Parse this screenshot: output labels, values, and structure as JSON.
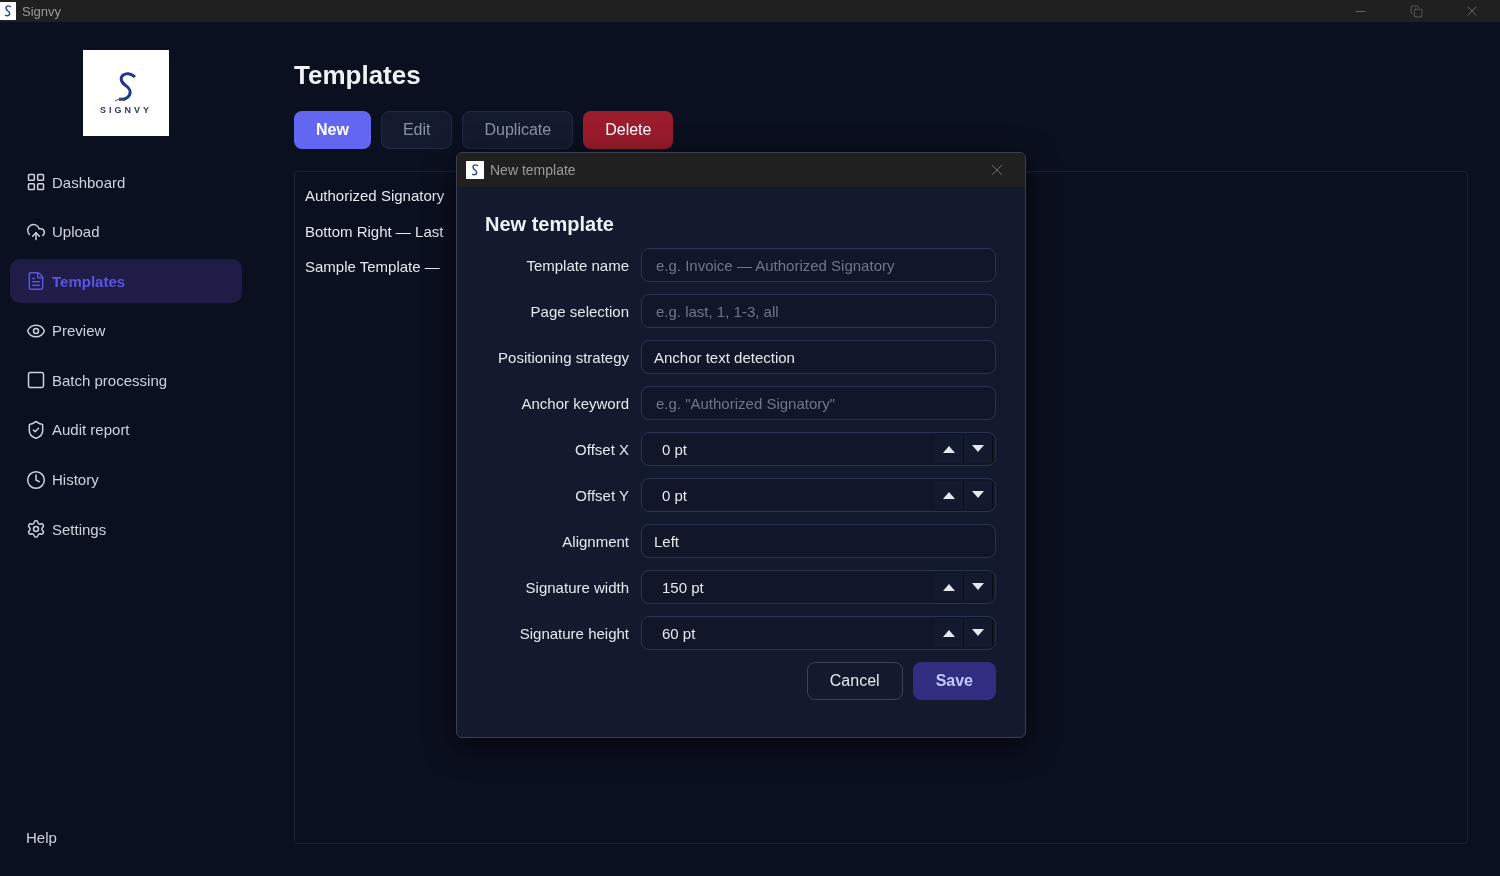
{
  "window": {
    "title": "Signvy"
  },
  "logo": {
    "wordmark": "SIGNVY"
  },
  "sidebar": {
    "items": [
      {
        "label": "Dashboard",
        "selected": false
      },
      {
        "label": "Upload",
        "selected": false
      },
      {
        "label": "Templates",
        "selected": true
      },
      {
        "label": "Preview",
        "selected": false
      },
      {
        "label": "Batch processing",
        "selected": false
      },
      {
        "label": "Audit report",
        "selected": false
      },
      {
        "label": "History",
        "selected": false
      },
      {
        "label": "Settings",
        "selected": false
      }
    ],
    "footer": "Help"
  },
  "page": {
    "title": "Templates",
    "toolbar": [
      {
        "label": "New",
        "kind": "primary"
      },
      {
        "label": "Edit",
        "kind": "secondary"
      },
      {
        "label": "Duplicate",
        "kind": "secondary"
      },
      {
        "label": "Delete",
        "kind": "danger"
      }
    ],
    "templates": [
      "Authorized Signatory",
      "Bottom Right — Last",
      "Sample Template —"
    ]
  },
  "dialog": {
    "window_title": "New template",
    "title": "New template",
    "fields": [
      {
        "label": "Template name",
        "kind": "text",
        "placeholder": "e.g. Invoice — Authorized Signatory"
      },
      {
        "label": "Page selection",
        "kind": "text",
        "placeholder": "e.g. last, 1, 1-3, all"
      },
      {
        "label": "Positioning strategy",
        "kind": "select",
        "value": "Anchor text detection"
      },
      {
        "label": "Anchor keyword",
        "kind": "text",
        "placeholder": "e.g. \"Authorized Signatory\""
      },
      {
        "label": "Offset X",
        "kind": "spin",
        "value": "0 pt"
      },
      {
        "label": "Offset Y",
        "kind": "spin",
        "value": "0 pt"
      },
      {
        "label": "Alignment",
        "kind": "select",
        "value": "Left"
      },
      {
        "label": "Signature width",
        "kind": "spin",
        "value": "150 pt"
      },
      {
        "label": "Signature height",
        "kind": "spin",
        "value": "60 pt"
      }
    ],
    "buttons": [
      {
        "label": "Cancel",
        "kind": "secondary"
      },
      {
        "label": "Save",
        "kind": "primary"
      }
    ]
  }
}
